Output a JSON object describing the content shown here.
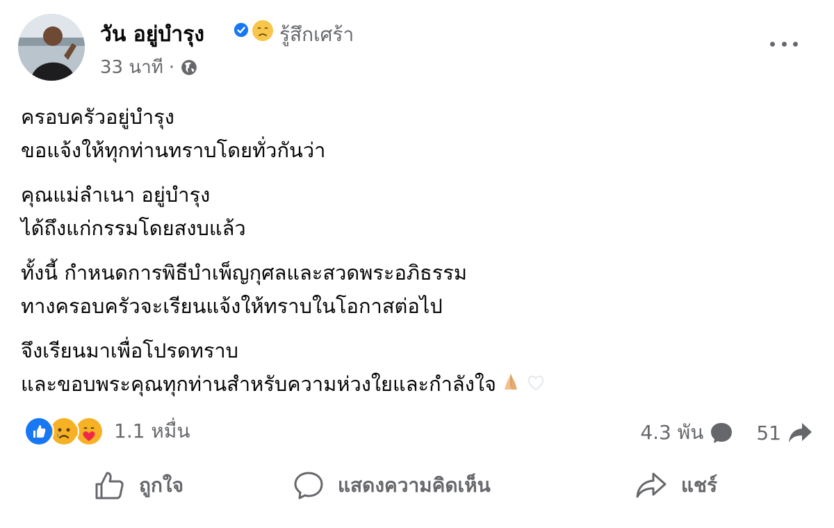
{
  "post": {
    "author_name": "วัน อยู่บำรุง",
    "feeling": "รู้สึกเศร้า",
    "time": "33 นาที",
    "meta_separator": "·",
    "icons": {
      "verified": "verified-badge-icon",
      "feeling": "sad-face-icon",
      "audience": "globe-icon",
      "more": "more-options-icon"
    },
    "paragraphs": [
      {
        "lines": [
          "ครอบครัวอยู่บำรุง",
          "ขอแจ้งให้ทุกท่านทราบโดยทั่วกันว่า"
        ]
      },
      {
        "lines": [
          "คุณแม่ลำเนา อยู่บำรุง",
          "ได้ถึงแก่กรรมโดยสงบแล้ว"
        ]
      },
      {
        "lines": [
          "ทั้งนี้ กำหนดการพิธีบำเพ็ญกุศลและสวดพระอภิธรรม",
          "ทางครอบครัวจะเรียนแจ้งให้ทราบในโอกาสต่อไป"
        ]
      },
      {
        "lines": [
          "จึงเรียนมาเพื่อโปรดทราบ",
          "และขอบพระคุณทุกท่านสำหรับความห่วงใยและกำลังใจ"
        ]
      }
    ],
    "trailing_emojis": [
      "folded-hands-icon",
      "white-heart-icon"
    ]
  },
  "engagement": {
    "reaction_icons": [
      "like-reaction-icon",
      "sad-reaction-icon",
      "care-reaction-icon"
    ],
    "reactions_count": "1.1 หมื่น",
    "comments_count": "4.3 พัน",
    "shares_count": "51"
  },
  "actions": {
    "like_label": "ถูกใจ",
    "comment_label": "แสดงความคิดเห็น",
    "share_label": "แชร์"
  },
  "colors": {
    "primary_text": "#050505",
    "secondary_text": "#65676b",
    "verified_blue": "#1877f2",
    "like_blue": "#1877f2",
    "reaction_yellow": "#f7b125"
  }
}
